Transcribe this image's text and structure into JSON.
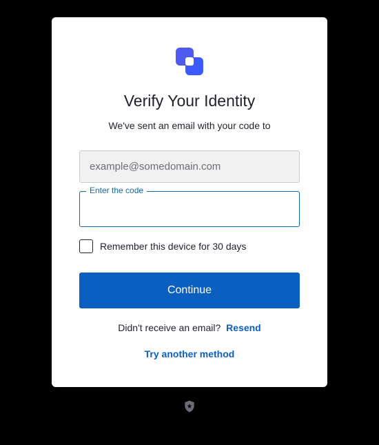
{
  "title": "Verify Your Identity",
  "subtitle": "We've sent an email with your code to",
  "email": "example@somedomain.com",
  "code_field": {
    "label": "Enter the code",
    "value": ""
  },
  "remember": {
    "label": "Remember this device for 30 days",
    "checked": false
  },
  "continue_label": "Continue",
  "resend": {
    "prompt": "Didn't receive an email?",
    "action": "Resend"
  },
  "try_another_label": "Try another method",
  "colors": {
    "primary": "#0b5fc0",
    "field_border": "#0d6aa8",
    "logo_primary": "#4f5bf0",
    "logo_secondary": "#3b5bff"
  }
}
